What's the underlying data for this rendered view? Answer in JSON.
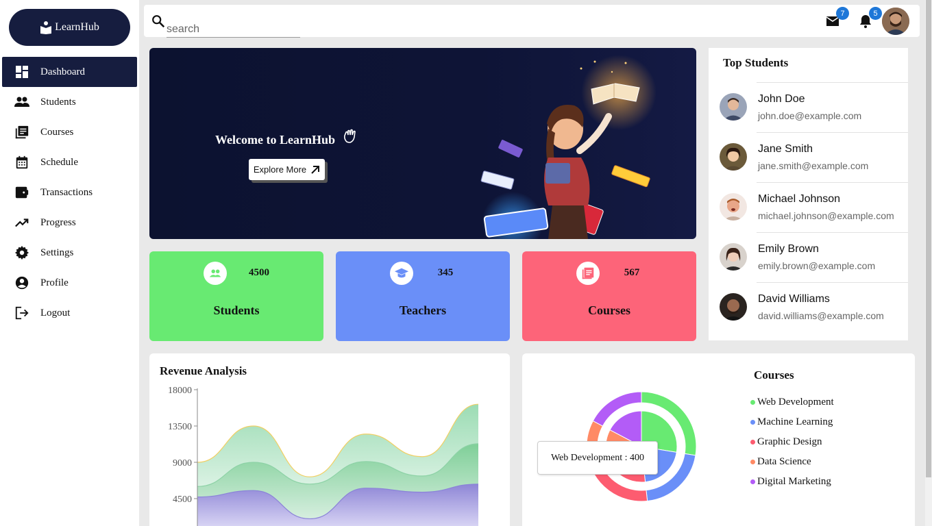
{
  "app": {
    "logo_text": "LearnHub"
  },
  "sidebar": {
    "items": [
      {
        "label": "Dashboard",
        "icon": "dashboard-icon",
        "active": true
      },
      {
        "label": "Students",
        "icon": "people-icon"
      },
      {
        "label": "Courses",
        "icon": "library-books-icon"
      },
      {
        "label": "Schedule",
        "icon": "calendar-icon"
      },
      {
        "label": "Transactions",
        "icon": "wallet-icon"
      },
      {
        "label": "Progress",
        "icon": "trending-up-icon"
      },
      {
        "label": "Settings",
        "icon": "gear-icon"
      },
      {
        "label": "Profile",
        "icon": "account-circle-icon"
      },
      {
        "label": "Logout",
        "icon": "logout-icon"
      }
    ]
  },
  "topbar": {
    "search_placeholder": "search",
    "mail_count": "7",
    "notification_count": "5"
  },
  "hero": {
    "title": "Welcome to LearnHub",
    "button_label": "Explore More"
  },
  "stats": [
    {
      "label": "Students",
      "value": "4500",
      "color": "#68ea72",
      "icon": "group-icon"
    },
    {
      "label": "Teachers",
      "value": "345",
      "color": "#6a8ff8",
      "icon": "graduation-cap-icon"
    },
    {
      "label": "Courses",
      "value": "567",
      "color": "#fd6479",
      "icon": "book-icon"
    }
  ],
  "top_students": {
    "title": "Top Students",
    "items": [
      {
        "name": "John Doe",
        "email": "john.doe@example.com"
      },
      {
        "name": "Jane Smith",
        "email": "jane.smith@example.com"
      },
      {
        "name": "Michael Johnson",
        "email": "michael.johnson@example.com"
      },
      {
        "name": "Emily Brown",
        "email": "emily.brown@example.com"
      },
      {
        "name": "David Williams",
        "email": "david.williams@example.com"
      }
    ]
  },
  "revenue": {
    "title": "Revenue Analysis"
  },
  "courses_chart": {
    "title": "Courses",
    "tooltip": "Web Development : 400"
  },
  "chart_data": [
    {
      "type": "area",
      "title": "Revenue Analysis",
      "yticks": [
        18000,
        13500,
        9000,
        4500
      ],
      "ylim": [
        0,
        18000
      ],
      "grid": false,
      "series": [
        {
          "values": [
            4700,
            5500,
            2000,
            5800,
            5300,
            6300
          ],
          "color": "#8b83d8"
        },
        {
          "values": [
            6000,
            9000,
            6300,
            9100,
            7300,
            11300
          ],
          "color": "#8dd2a6"
        },
        {
          "values": [
            9000,
            13500,
            7200,
            12500,
            9700,
            16200
          ],
          "color": "#f2cf62"
        }
      ]
    },
    {
      "type": "pie",
      "title": "Courses",
      "legend": "right",
      "categories": [
        "Web Development",
        "Machine Learning",
        "Graphic Design",
        "Data Science",
        "Digital Marketing"
      ],
      "colors": [
        "#68ea72",
        "#6a8ff8",
        "#fd5c70",
        "#ff8a65",
        "#b35cf7"
      ],
      "outer_values": [
        400,
        300,
        350,
        150,
        250
      ],
      "inner_values": [
        400,
        300,
        350,
        150,
        250
      ]
    }
  ]
}
